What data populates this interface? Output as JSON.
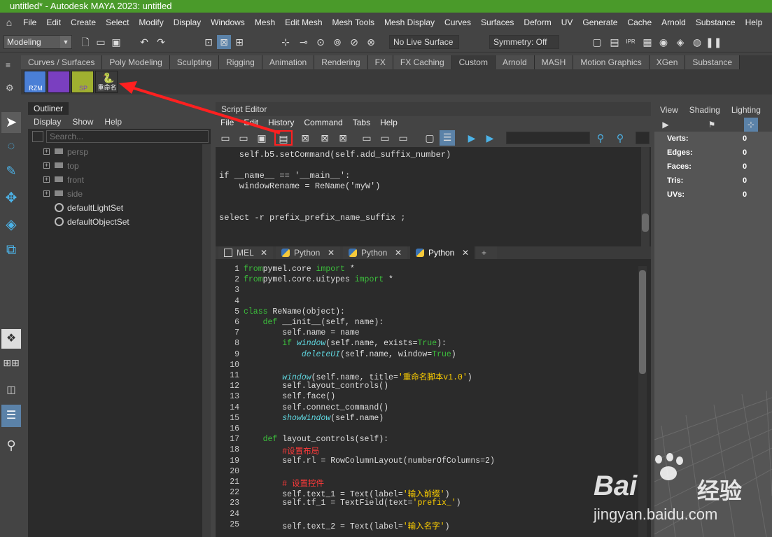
{
  "window": {
    "title": "untitled* - Autodesk MAYA 2023: untitled"
  },
  "menu": [
    "File",
    "Edit",
    "Create",
    "Select",
    "Modify",
    "Display",
    "Windows",
    "Mesh",
    "Edit Mesh",
    "Mesh Tools",
    "Mesh Display",
    "Curves",
    "Surfaces",
    "Deform",
    "UV",
    "Generate",
    "Cache",
    "Arnold",
    "Substance",
    "Help"
  ],
  "status": {
    "mode": "Modeling",
    "live_surface": "No Live Surface",
    "symmetry": "Symmetry: Off"
  },
  "shelf": {
    "tabs": [
      "Curves / Surfaces",
      "Poly Modeling",
      "Sculpting",
      "Rigging",
      "Animation",
      "Rendering",
      "FX",
      "FX Caching",
      "Custom",
      "Arnold",
      "MASH",
      "Motion Graphics",
      "XGen",
      "Substance"
    ],
    "active_tab": "Custom",
    "buttons": [
      {
        "label": "RZM",
        "color": "#4a7fd6"
      },
      {
        "label": "",
        "color": "#7a3fc0"
      },
      {
        "label": "SP",
        "color": "#a0b030"
      },
      {
        "label": "重命名",
        "color": "#3a3a3a"
      }
    ]
  },
  "outliner": {
    "title": "Outliner",
    "menu": [
      "Display",
      "Show",
      "Help"
    ],
    "search_placeholder": "Search...",
    "items": [
      {
        "label": "persp",
        "dim": true
      },
      {
        "label": "top",
        "dim": true
      },
      {
        "label": "front",
        "dim": true
      },
      {
        "label": "side",
        "dim": true
      },
      {
        "label": "defaultLightSet",
        "dim": false
      },
      {
        "label": "defaultObjectSet",
        "dim": false
      }
    ]
  },
  "script_editor": {
    "title": "Script Editor",
    "menu": [
      "File",
      "Edit",
      "History",
      "Command",
      "Tabs",
      "Help"
    ],
    "history": [
      "    self.b5.setCommand(self.add_suffix_number)",
      "",
      "if __name__ == '__main__':",
      "    windowRename = ReName('myW')",
      "",
      "",
      "select -r prefix_prefix_name_suffix ;"
    ],
    "tabs": [
      {
        "label": "MEL",
        "icon": "mel-icon"
      },
      {
        "label": "Python",
        "icon": "python-icon"
      },
      {
        "label": "Python",
        "icon": "python-icon"
      },
      {
        "label": "Python",
        "icon": "python-icon",
        "active": true
      },
      {
        "label": "+"
      }
    ],
    "code": [
      {
        "n": "1",
        "parts": [
          [
            "kw",
            "from"
          ],
          [
            "",
            "pymel.core "
          ],
          [
            "kw",
            "import"
          ],
          [
            "",
            " *"
          ]
        ]
      },
      {
        "n": "2",
        "parts": [
          [
            "kw",
            "from"
          ],
          [
            "",
            "pymel.core.uitypes "
          ],
          [
            "kw",
            "import"
          ],
          [
            "",
            " *"
          ]
        ]
      },
      {
        "n": "3",
        "parts": []
      },
      {
        "n": "4",
        "parts": []
      },
      {
        "n": "5",
        "parts": [
          [
            "kw",
            "class"
          ],
          [
            "",
            " ReName(object):"
          ]
        ]
      },
      {
        "n": "6",
        "parts": [
          [
            "",
            "    "
          ],
          [
            "kw",
            "def"
          ],
          [
            "",
            " __init__(self, name):"
          ]
        ]
      },
      {
        "n": "7",
        "parts": [
          [
            "",
            "        self.name = name"
          ]
        ]
      },
      {
        "n": "8",
        "parts": [
          [
            "",
            "        "
          ],
          [
            "kw",
            "if"
          ],
          [
            "",
            " "
          ],
          [
            "fn",
            "window"
          ],
          [
            "",
            "(self.name, exists="
          ],
          [
            "kw",
            "True"
          ],
          [
            "",
            "):"
          ]
        ]
      },
      {
        "n": "9",
        "parts": [
          [
            "",
            "            "
          ],
          [
            "fn",
            "deleteUI"
          ],
          [
            "",
            "(self.name, window="
          ],
          [
            "kw",
            "True"
          ],
          [
            ")",
            ")"
          ]
        ]
      },
      {
        "n": "10",
        "parts": []
      },
      {
        "n": "11",
        "parts": [
          [
            "",
            "        "
          ],
          [
            "fn",
            "window"
          ],
          [
            "",
            "(self.name, title="
          ],
          [
            "tr",
            "'重命名脚本v1.0'"
          ],
          [
            "",
            ")"
          ]
        ]
      },
      {
        "n": "12",
        "parts": [
          [
            "",
            "        self.layout_controls()"
          ]
        ]
      },
      {
        "n": "13",
        "parts": [
          [
            "",
            "        self.face()"
          ]
        ]
      },
      {
        "n": "14",
        "parts": [
          [
            "",
            "        self.connect_command()"
          ]
        ]
      },
      {
        "n": "15",
        "parts": [
          [
            "",
            "        "
          ],
          [
            "fn",
            "showWindow"
          ],
          [
            "",
            "(self.name)"
          ]
        ]
      },
      {
        "n": "16",
        "parts": []
      },
      {
        "n": "17",
        "parts": [
          [
            "",
            "    "
          ],
          [
            "kw",
            "def"
          ],
          [
            "",
            " layout_controls(self):"
          ]
        ]
      },
      {
        "n": "18",
        "parts": [
          [
            "",
            "        "
          ],
          [
            "cm",
            "#设置布局"
          ]
        ]
      },
      {
        "n": "19",
        "parts": [
          [
            "",
            "        self.rl = RowColumnLayout(numberOfColumns=2)"
          ]
        ]
      },
      {
        "n": "20",
        "parts": []
      },
      {
        "n": "21",
        "parts": [
          [
            "",
            "        "
          ],
          [
            "cm",
            "# 设置控件"
          ]
        ]
      },
      {
        "n": "22",
        "parts": [
          [
            "",
            "        self.text_1 = Text(label="
          ],
          [
            "tr",
            "'输入前缀'"
          ],
          [
            "",
            ")"
          ]
        ]
      },
      {
        "n": "23",
        "parts": [
          [
            "",
            "        self.tf_1 = TextField(text="
          ],
          [
            "tr",
            "'prefix_'"
          ],
          [
            "",
            ")"
          ]
        ]
      },
      {
        "n": "24",
        "parts": []
      },
      {
        "n": "25",
        "parts": [
          [
            "",
            "        self.text_2 = Text(label="
          ],
          [
            "tr",
            "'输入名字'"
          ],
          [
            "",
            ")"
          ]
        ]
      }
    ]
  },
  "viewport": {
    "menu": [
      "View",
      "Shading",
      "Lighting"
    ],
    "hud": [
      {
        "label": "Verts:",
        "value": "0"
      },
      {
        "label": "Edges:",
        "value": "0"
      },
      {
        "label": "Faces:",
        "value": "0"
      },
      {
        "label": "Tris:",
        "value": "0"
      },
      {
        "label": "UVs:",
        "value": "0"
      }
    ]
  },
  "watermark": {
    "brand": "Bai",
    "brand2": "经验",
    "url": "jingyan.baidu.com"
  },
  "colors": {
    "title_green": "#4a9a2a",
    "annotation_red": "#ff2020",
    "keyword": "#3cbf3c",
    "function": "#5fd7e0",
    "string": "#ffd000",
    "comment": "#ff3a3a"
  }
}
